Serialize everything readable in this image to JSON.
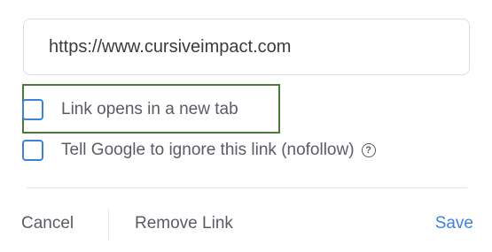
{
  "link_editor": {
    "url_value": "https://www.cursiveimpact.com",
    "options": {
      "new_tab": {
        "label": "Link opens in a new tab",
        "checked": false
      },
      "nofollow": {
        "label": "Tell Google to ignore this link (nofollow)",
        "checked": false
      }
    },
    "help_icon_glyph": "?",
    "buttons": {
      "cancel": "Cancel",
      "remove_link": "Remove Link",
      "save": "Save"
    }
  },
  "colors": {
    "accent": "#3e82d6",
    "highlight_border": "#4c7a34",
    "text": "#595c63",
    "divider": "#e3e6ea"
  },
  "icons": {
    "help": "help-circle-icon"
  }
}
